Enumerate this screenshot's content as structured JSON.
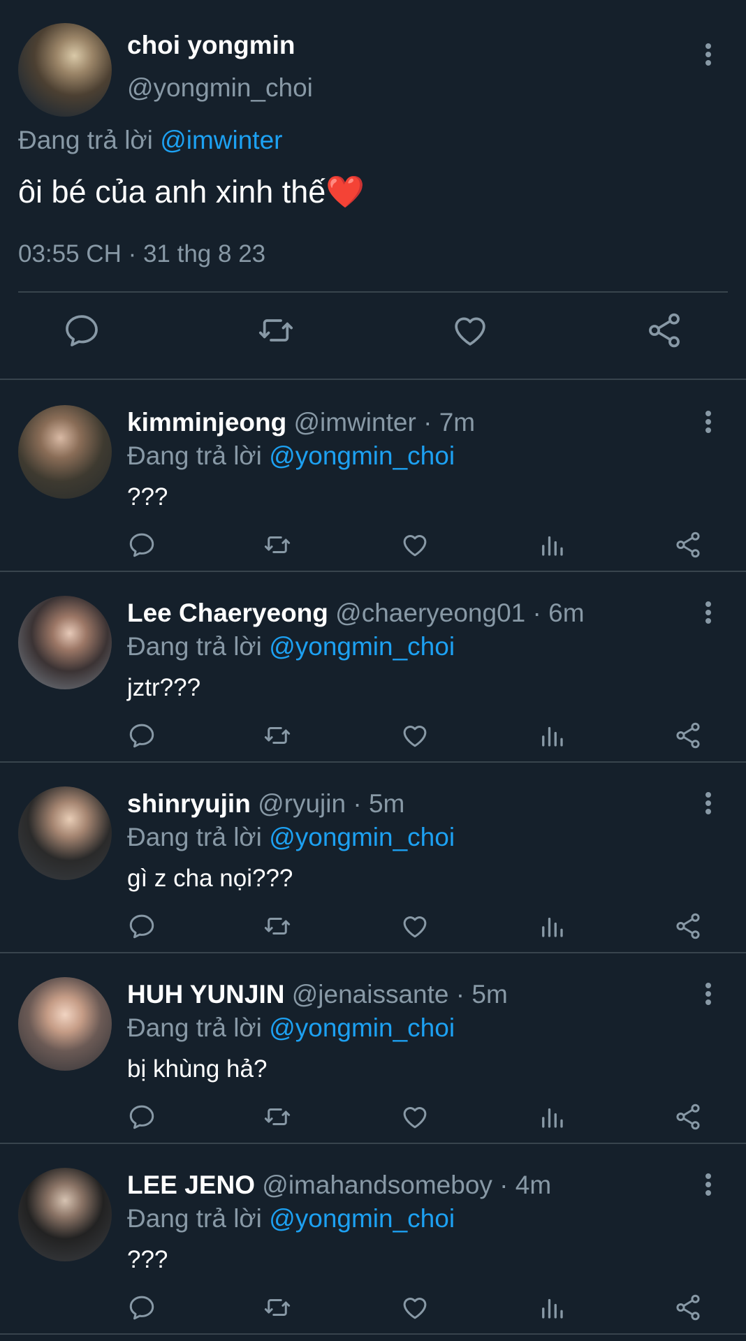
{
  "main_tweet": {
    "name": "choi yongmin",
    "handle": "@yongmin_choi",
    "replying_prefix": "Đang trả lời ",
    "replying_to": "@imwinter",
    "text": "ôi bé của anh xinh thế",
    "emoji": "❤️",
    "timestamp": "03:55 CH · 31 thg 8 23"
  },
  "replies": [
    {
      "name": "kimminjeong",
      "handle": "@imwinter",
      "age": "7m",
      "replying_prefix": "Đang trả lời ",
      "replying_to": "@yongmin_choi",
      "text": "???"
    },
    {
      "name": "Lee Chaeryeong",
      "handle": "@chaeryeong01",
      "age": "6m",
      "replying_prefix": "Đang trả lời ",
      "replying_to": "@yongmin_choi",
      "text": "jztr???"
    },
    {
      "name": "shinryujin",
      "handle": "@ryujin",
      "age": "5m",
      "replying_prefix": "Đang trả lời ",
      "replying_to": "@yongmin_choi",
      "text": "gì z cha nọi???"
    },
    {
      "name": "HUH YUNJIN",
      "handle": "@jenaissante",
      "age": "5m",
      "replying_prefix": "Đang trả lời ",
      "replying_to": "@yongmin_choi",
      "text": "bị khùng hả?"
    },
    {
      "name": "LEE JENO",
      "handle": "@imahandsomeboy",
      "age": "4m",
      "replying_prefix": "Đang trả lời ",
      "replying_to": "@yongmin_choi",
      "text": "???"
    }
  ],
  "separator": " · ",
  "icons": {
    "reply": "reply-icon",
    "retweet": "retweet-icon",
    "like": "like-icon",
    "analytics": "analytics-icon",
    "share": "share-icon",
    "more": "more-vertical-icon"
  },
  "colors": {
    "background": "#15202b",
    "muted": "#8899a6",
    "link": "#1da1f2",
    "divider": "#38444d"
  }
}
